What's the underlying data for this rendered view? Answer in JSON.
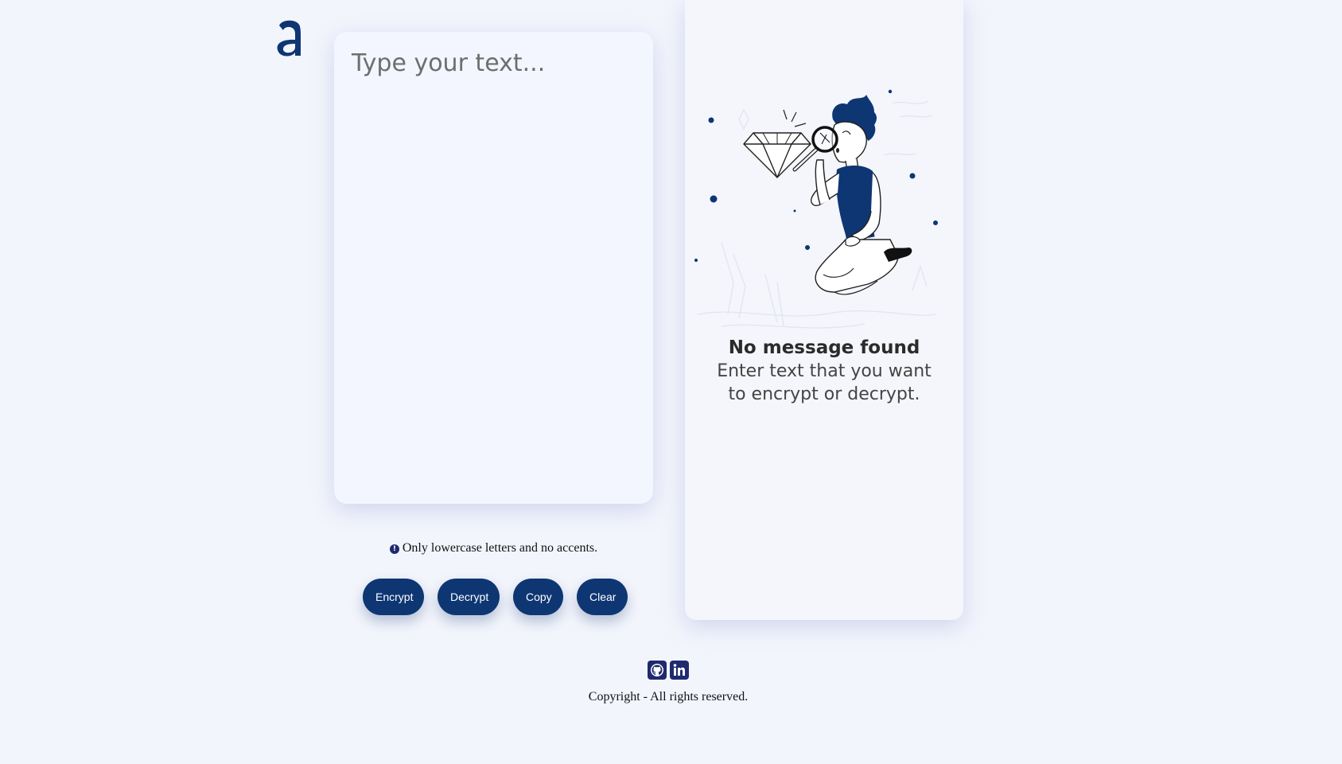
{
  "logo": {
    "icon": "letter-a-logo",
    "color": "#0e3673"
  },
  "input": {
    "placeholder": "Type your text..."
  },
  "hint": {
    "icon": "info-icon",
    "text": "Only lowercase letters and no accents."
  },
  "buttons": {
    "encrypt": "Encrypt",
    "decrypt": "Decrypt",
    "copy": "Copy",
    "clear": "Clear"
  },
  "output": {
    "illustration": "person-with-magnifier-and-diamond-illustration",
    "title": "No message found",
    "subtitle": "Enter text that you want to encrypt or decrypt."
  },
  "footer": {
    "social": [
      {
        "icon": "github-icon"
      },
      {
        "icon": "linkedin-icon"
      }
    ],
    "copyright": "Copyright - All rights reserved."
  },
  "colors": {
    "accent": "#0e3673",
    "background": "#f3f5fc",
    "icon_badge": "#1f2a6e"
  }
}
